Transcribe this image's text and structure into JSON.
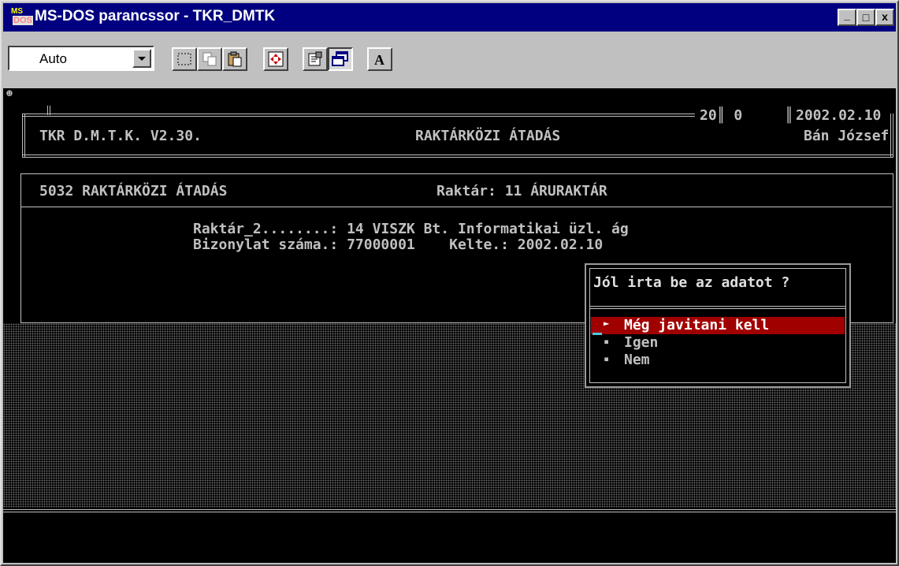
{
  "window": {
    "title": "MS-DOS parancssor - TKR_DMTK"
  },
  "app_icon": {
    "top_text": "MS",
    "bottom_text": "DOS"
  },
  "window_controls": {
    "minimize": "_",
    "maximize": "□",
    "close": "x"
  },
  "toolbar": {
    "font_size_value": "Auto"
  },
  "header": {
    "counters": "20║ 0",
    "date": "2002.02.10",
    "program": "TKR D.M.T.K. V2.30.",
    "screen_title": "RAKTÁRKÖZI ÁTADÁS",
    "user": "Bán József"
  },
  "panel": {
    "title": "5032 RAKTÁRKÖZI ÁTADÁS",
    "warehouse": "Raktár: 11 ÁRURAKTÁR",
    "line1": "Raktár_2........: 14 VISZK Bt. Informatikai üzl. ág",
    "line2": "Bizonylat száma.: 77000001    Kelte.: 2002.02.10"
  },
  "dialog": {
    "question": "Jól irta be az adatot ?",
    "options": [
      {
        "marker": "►",
        "label": "Még javitani kell"
      },
      {
        "marker": "▪",
        "label": "Igen"
      },
      {
        "marker": "▪",
        "label": "Nem"
      }
    ]
  },
  "console": {
    "corner_glyph": "☻"
  },
  "colors": {
    "titlebar": "#000080",
    "selection": "#a00000",
    "text": "#c0c0c0",
    "background": "#000000"
  }
}
